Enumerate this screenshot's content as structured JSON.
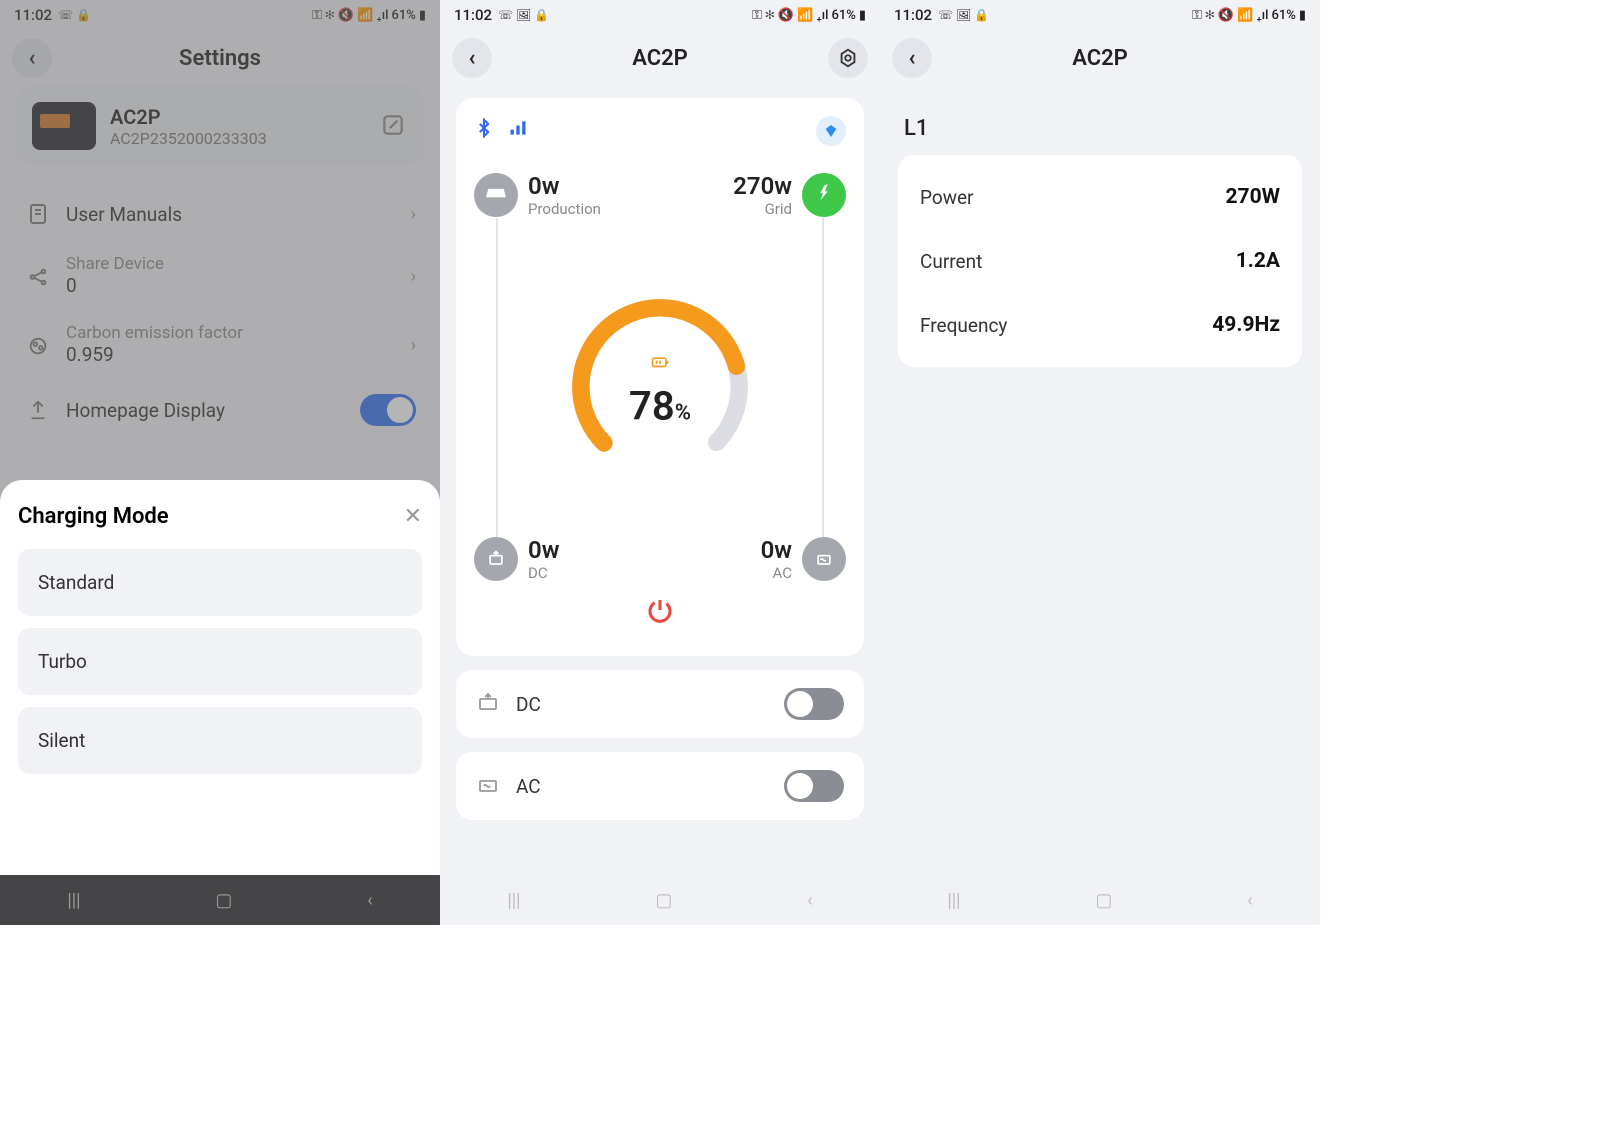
{
  "statusBar": {
    "time": "11:02",
    "battery": "61%",
    "iconsLeft1": "☏ 🔒",
    "iconsLeft2": "☏ 🖼 🔒",
    "iconsRight": "⚿ ✻ 🔇 📶 ₊ıl"
  },
  "screen1": {
    "title": "Settings",
    "deviceName": "AC2P",
    "deviceSerial": "AC2P2352000233303",
    "rows": {
      "manuals": "User Manuals",
      "shareLabel": "Share Device",
      "shareValue": "0",
      "carbonLabel": "Carbon emission factor",
      "carbonValue": "0.959",
      "homepage": "Homepage Display"
    },
    "sheetTitle": "Charging Mode",
    "modes": [
      "Standard",
      "Turbo",
      "Silent"
    ]
  },
  "screen2": {
    "title": "AC2P",
    "production": {
      "value": "0w",
      "label": "Production"
    },
    "grid": {
      "value": "270w",
      "label": "Grid"
    },
    "dc": {
      "value": "0w",
      "label": "DC"
    },
    "ac": {
      "value": "0w",
      "label": "AC"
    },
    "batteryPct": "78",
    "pctSign": "%",
    "dcToggleLabel": "DC",
    "acToggleLabel": "AC"
  },
  "screen3": {
    "title": "AC2P",
    "section": "L1",
    "metrics": {
      "powerLabel": "Power",
      "powerValue": "270W",
      "currentLabel": "Current",
      "currentValue": "1.2A",
      "freqLabel": "Frequency",
      "freqValue": "49.9Hz"
    }
  }
}
